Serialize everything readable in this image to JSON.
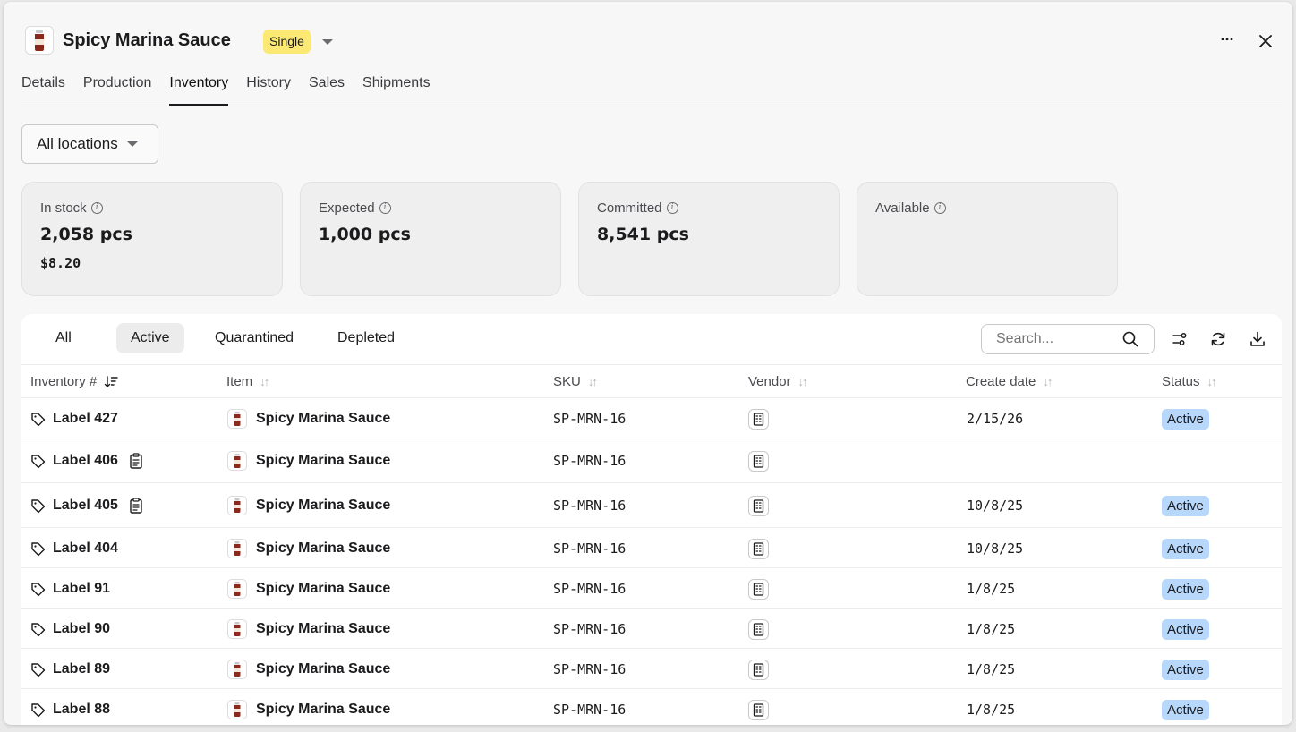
{
  "header": {
    "title": "Spicy Marina Sauce",
    "type_badge": "Single",
    "more_label": "···",
    "tabs": [
      {
        "label": "Details"
      },
      {
        "label": "Production"
      },
      {
        "label": "Inventory"
      },
      {
        "label": "History"
      },
      {
        "label": "Sales"
      },
      {
        "label": "Shipments"
      }
    ],
    "active_tab": "Inventory"
  },
  "location_filter": {
    "label": "All locations"
  },
  "stats": [
    {
      "label": "In stock",
      "value": "2,058 pcs",
      "sub": "$8.20"
    },
    {
      "label": "Expected",
      "value": "1,000 pcs",
      "sub": ""
    },
    {
      "label": "Committed",
      "value": "8,541 pcs",
      "sub": ""
    },
    {
      "label": "Available",
      "value": "",
      "sub": ""
    }
  ],
  "status_filters": [
    {
      "label": "All"
    },
    {
      "label": "Active"
    },
    {
      "label": "Quarantined"
    },
    {
      "label": "Depleted"
    }
  ],
  "active_status_filter": "Active",
  "search": {
    "placeholder": "Search..."
  },
  "table": {
    "columns": [
      "Inventory #",
      "Item",
      "SKU",
      "Vendor",
      "Create date",
      "Status"
    ],
    "rows": [
      {
        "label": "Label 427",
        "item": "Spicy Marina Sauce",
        "sku": "SP-MRN-16",
        "date": "2/15/26",
        "status": "Active",
        "note": false
      },
      {
        "label": "Label 406",
        "item": "Spicy Marina Sauce",
        "sku": "SP-MRN-16",
        "date": "",
        "status": "",
        "note": true
      },
      {
        "label": "Label 405",
        "item": "Spicy Marina Sauce",
        "sku": "SP-MRN-16",
        "date": "10/8/25",
        "status": "Active",
        "note": true
      },
      {
        "label": "Label 404",
        "item": "Spicy Marina Sauce",
        "sku": "SP-MRN-16",
        "date": "10/8/25",
        "status": "Active",
        "note": false
      },
      {
        "label": "Label 91",
        "item": "Spicy Marina Sauce",
        "sku": "SP-MRN-16",
        "date": "1/8/25",
        "status": "Active",
        "note": false
      },
      {
        "label": "Label 90",
        "item": "Spicy Marina Sauce",
        "sku": "SP-MRN-16",
        "date": "1/8/25",
        "status": "Active",
        "note": false
      },
      {
        "label": "Label 89",
        "item": "Spicy Marina Sauce",
        "sku": "SP-MRN-16",
        "date": "1/8/25",
        "status": "Active",
        "note": false
      },
      {
        "label": "Label 88",
        "item": "Spicy Marina Sauce",
        "sku": "SP-MRN-16",
        "date": "1/8/25",
        "status": "Active",
        "note": false
      }
    ]
  },
  "colors": {
    "badge_single": "#fbe974",
    "status_active": "#b8d8fb",
    "sauce_jar": "#8b2a1c"
  },
  "icons": [
    "sauce-jar-icon",
    "chevron-down-icon",
    "more-icon",
    "close-icon",
    "info-icon",
    "search-icon",
    "filter-icon",
    "refresh-icon",
    "download-icon",
    "tag-icon",
    "note-icon",
    "building-icon",
    "sort-icon"
  ]
}
